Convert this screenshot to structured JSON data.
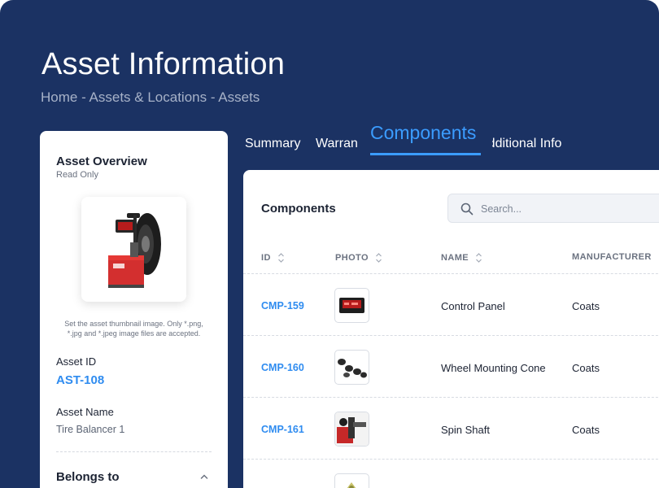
{
  "header": {
    "title": "Asset Information",
    "breadcrumb": [
      "Home",
      "Assets & Locations",
      "Assets"
    ],
    "breadcrumb_sep": " - "
  },
  "overview": {
    "title": "Asset Overview",
    "subtitle": "Read Only",
    "thumbnail_hint": "Set the asset thumbnail image. Only *.png, *.jpg and *.jpeg image files are accepted.",
    "asset_id_label": "Asset ID",
    "asset_id": "AST-108",
    "asset_name_label": "Asset Name",
    "asset_name": "Tire Balancer 1",
    "belongs_to_label": "Belongs to"
  },
  "tabs": [
    {
      "label": "Summary",
      "active": false
    },
    {
      "label": "Warranty",
      "active": false
    },
    {
      "label": "Components",
      "active": true
    },
    {
      "label": "Additional Info",
      "active": false
    }
  ],
  "components": {
    "title": "Components",
    "search_placeholder": "Search...",
    "columns": [
      "ID",
      "PHOTO",
      "NAME",
      "MANUFACTURER"
    ],
    "rows": [
      {
        "id": "CMP-159",
        "photo_icon": "control-panel-photo",
        "name": "Control Panel",
        "manufacturer": "Coats"
      },
      {
        "id": "CMP-160",
        "photo_icon": "cones-photo",
        "name": "Wheel Mounting Cone",
        "manufacturer": "Coats"
      },
      {
        "id": "CMP-161",
        "photo_icon": "shaft-photo",
        "name": "Spin Shaft",
        "manufacturer": "Coats"
      },
      {
        "id": "",
        "photo_icon": "partial-photo",
        "name": "",
        "manufacturer": ""
      }
    ]
  },
  "colors": {
    "background": "#1b3263",
    "accent": "#2f8cf0",
    "active_tab": "#3b9cff"
  }
}
